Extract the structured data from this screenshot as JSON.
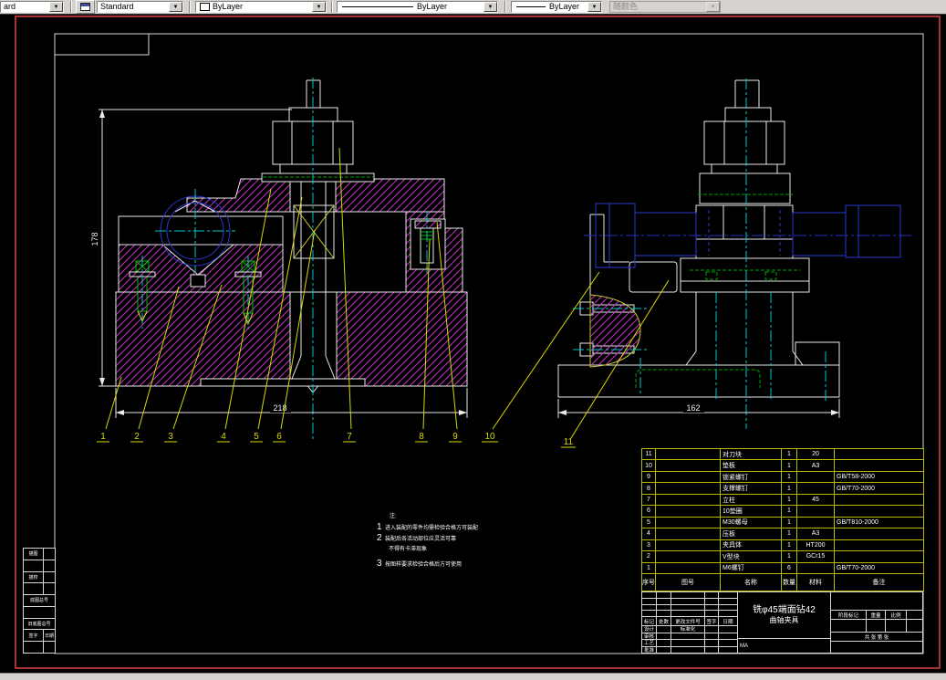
{
  "toolbar": {
    "dim_style_partial": "ard",
    "text_style": "Standard",
    "color": "ByLayer",
    "linetype": "ByLayer",
    "lineweight": "ByLayer",
    "plot_style": "随颜色"
  },
  "drawing": {
    "dims": {
      "front_height": "178",
      "front_width": "218",
      "side_width": "162"
    },
    "balloons": [
      "1",
      "2",
      "3",
      "4",
      "5",
      "6",
      "7",
      "8",
      "9",
      "10",
      "11"
    ],
    "notes": {
      "label": "注:",
      "items": [
        {
          "num": "1",
          "line1": "进入装配的零件均需检验合格方可装配",
          "line2": ""
        },
        {
          "num": "2",
          "line1": "装配后各活动部位应灵活可靠",
          "line2": "不得有卡滞现象"
        },
        {
          "num": "3",
          "line1": "按图样要求检验合格后方可使用",
          "line2": ""
        }
      ]
    }
  },
  "bom": {
    "headers": [
      "序号",
      "图号",
      "名称",
      "数量",
      "材料",
      "备注"
    ],
    "rows": [
      {
        "no": "11",
        "dwg": "",
        "name": "对刀块",
        "qty": "1",
        "material": "20",
        "note": ""
      },
      {
        "no": "10",
        "dwg": "",
        "name": "垫板",
        "qty": "1",
        "material": "A3",
        "note": ""
      },
      {
        "no": "9",
        "dwg": "",
        "name": "锁紧螺钉",
        "qty": "1",
        "material": "",
        "note": "GB/T58-2000"
      },
      {
        "no": "8",
        "dwg": "",
        "name": "支撑螺钉",
        "qty": "1",
        "material": "",
        "note": "GB/T70-2000"
      },
      {
        "no": "7",
        "dwg": "",
        "name": "立柱",
        "qty": "1",
        "material": "45",
        "note": ""
      },
      {
        "no": "6",
        "dwg": "",
        "name": "10垫圈",
        "qty": "1",
        "material": "",
        "note": ""
      },
      {
        "no": "5",
        "dwg": "",
        "name": "M30螺母",
        "qty": "1",
        "material": "",
        "note": "GB/T810-2000"
      },
      {
        "no": "4",
        "dwg": "",
        "name": "压板",
        "qty": "1",
        "material": "A3",
        "note": ""
      },
      {
        "no": "3",
        "dwg": "",
        "name": "夹具体",
        "qty": "1",
        "material": "HT200",
        "note": ""
      },
      {
        "no": "2",
        "dwg": "",
        "name": "V型块",
        "qty": "1",
        "material": "GCr15",
        "note": ""
      },
      {
        "no": "1",
        "dwg": "",
        "name": "M6螺钉",
        "qty": "6",
        "material": "",
        "note": "GB/T70-2000"
      }
    ]
  },
  "titleblock": {
    "title_line1": "铣φ45端面钻42",
    "title_line2": "曲轴夹具",
    "rev_headers": [
      "标记",
      "处数",
      "更改文件号",
      "签字",
      "日期"
    ],
    "roles": [
      "设计",
      "审核",
      "工艺",
      "批准"
    ],
    "std_label": "标准化",
    "stage_labels": [
      "阶段标记",
      "重量",
      "比例",
      ""
    ],
    "sheet_text": "共 张 第 张",
    "bottom_mark": "MA"
  },
  "left_strip": {
    "rows": [
      "描图",
      "",
      "描校",
      "",
      "底图总号",
      "",
      "旧底图总号"
    ],
    "sign_label": "签字",
    "date_label": "日期"
  }
}
